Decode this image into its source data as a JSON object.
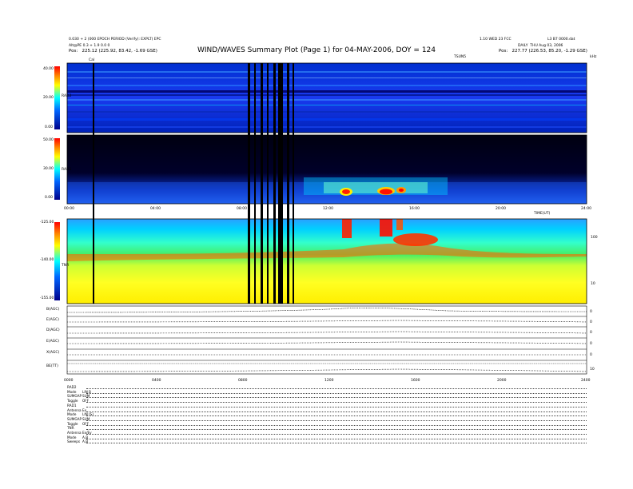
{
  "header": {
    "title": "WIND/WAVES Summary Plot (Page 1) for 04-MAY-2006, DOY = 124",
    "left_line1": "0.030 + 2 (000 EPOCH PERIOD (Verify): EXPLT) EPC",
    "left_line2": "Alt@PE 0.3 + 1.9 0.0 0",
    "left_pos": "Pos:   225.12 (225.92, 83.42, -1.69 GSE)",
    "right_line1": "1.10 WED 23 FCC",
    "right_line2": "L3 B7 0000.dat",
    "right_line3": "DAILY  THU Aug 03, 2006",
    "right_pos": "Pos:   227.77 (226.53, 85.20, -1.29 GSE)",
    "right_tag": "TSUN5",
    "far_right": "kHz"
  },
  "panels": {
    "rad2_label": "RAD2",
    "rad2_ticks": [
      "40.00",
      "20.00",
      "0.00"
    ],
    "rad1_label": "RAD1",
    "rad1_ticks": [
      "50.00",
      "30.00",
      "0.00"
    ],
    "tnr_label": "TNR",
    "tnr_ticks": [
      "-125.00",
      "-140.00",
      "-155.00"
    ],
    "tnr_right_ticks": [
      "100",
      "10"
    ],
    "time_ticks": [
      "00:00",
      "04:00",
      "08:00",
      "12:00",
      "16:00",
      "20:00",
      "24:00"
    ],
    "time_ticks_bottom": [
      "0000",
      "0400",
      "0800",
      "1200",
      "1600",
      "2000",
      "2400"
    ],
    "utc_label": "TIME(UT)",
    "marker": "Cal"
  },
  "line_panels": [
    {
      "label": "B(AGC)",
      "tick": "0"
    },
    {
      "label": "E(AGC)",
      "tick": "0"
    },
    {
      "label": "D(AGC)",
      "tick": "0"
    },
    {
      "label": "E(AGC)",
      "tick": "0"
    },
    {
      "label": "X(AGC)",
      "tick": "0"
    },
    {
      "label": "BE(TT)",
      "tick": "10"
    }
  ],
  "footer": [
    {
      "k": "RAD2",
      "v": ""
    },
    {
      "k": "Mode",
      "v": "LIN B"
    },
    {
      "k": "SUMGAP",
      "v": "SUM"
    },
    {
      "k": "Toggle",
      "v": "OFF"
    },
    {
      "k": "RAD1",
      "v": ""
    },
    {
      "k": "Antenna",
      "v": "Ex"
    },
    {
      "k": "Mode",
      "v": "LIN (S)"
    },
    {
      "k": "SUMGAP",
      "v": "SUM"
    },
    {
      "k": "Toggle",
      "v": "OFF"
    },
    {
      "k": "TNR",
      "v": ""
    },
    {
      "k": "Antenna",
      "v": "Ex/Ey"
    },
    {
      "k": "Mode",
      "v": "A,B"
    },
    {
      "k": "Sweeps",
      "v": "A,B"
    }
  ],
  "chart_data": [
    {
      "type": "heatmap",
      "name": "RAD2",
      "x": [
        0,
        24
      ],
      "ylim": [
        0,
        40
      ],
      "ylabel": "RAD2",
      "colors": [
        "#00008a",
        "#2255ff",
        "#00ddff",
        "#ffff00",
        "#ff0000"
      ]
    },
    {
      "type": "heatmap",
      "name": "RAD1",
      "x": [
        0,
        24
      ],
      "ylim": [
        0,
        50
      ],
      "ylabel": "RAD1",
      "colors": [
        "#000000",
        "#0000a0",
        "#2266ff",
        "#00ddff",
        "#ff0000"
      ]
    },
    {
      "type": "heatmap",
      "name": "TNR",
      "x": [
        0,
        24
      ],
      "ylim": [
        -155,
        -125
      ],
      "ylabel": "TNR",
      "colors": [
        "#ffff00",
        "#66ff66",
        "#00ccff",
        "#ff0000"
      ]
    }
  ]
}
